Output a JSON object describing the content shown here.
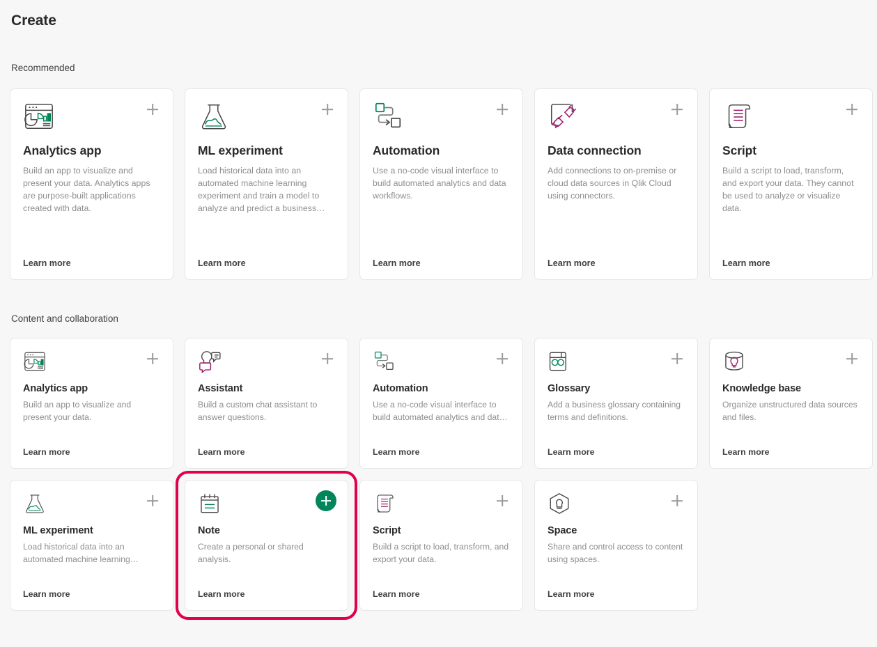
{
  "page": {
    "title": "Create"
  },
  "colors": {
    "background": "#f7f7f7",
    "card_background": "#ffffff",
    "card_border": "#e6e6e6",
    "accent_green": "#00865a",
    "focus_ring_pink": "#e0004d",
    "icon_green": "#00865a",
    "icon_magenta": "#9c1a6c",
    "icon_gray": "#4a4a4a",
    "title_text": "#2a2a2a",
    "body_text": "#8e8e8e"
  },
  "sections": [
    {
      "label": "Recommended",
      "card_size": "tall",
      "rows": [
        {
          "cards": [
            {
              "icon": "analytics-app-icon",
              "title": "Analytics app",
              "description": "Build an app to visualize and present your data. Analytics apps are purpose-built applications created with data.",
              "learn_more": "Learn more",
              "add_label": "+",
              "add_state": "default",
              "focused": false
            },
            {
              "icon": "ml-experiment-icon",
              "title": "ML experiment",
              "description": "Load historical data into an automated machine learning experiment and train a model to analyze and predict a business…",
              "learn_more": "Learn more",
              "add_label": "+",
              "add_state": "default",
              "focused": false
            },
            {
              "icon": "automation-icon",
              "title": "Automation",
              "description": "Use a no-code visual interface to build automated analytics and data workflows.",
              "learn_more": "Learn more",
              "add_label": "+",
              "add_state": "default",
              "focused": false
            },
            {
              "icon": "data-connection-icon",
              "title": "Data connection",
              "description": "Add connections to on-premise or cloud data sources in Qlik Cloud using connectors.",
              "learn_more": "Learn more",
              "add_label": "+",
              "add_state": "default",
              "focused": false
            },
            {
              "icon": "script-icon",
              "title": "Script",
              "description": "Build a script to load, transform, and export your data. They cannot be used to analyze or visualize data.",
              "learn_more": "Learn more",
              "add_label": "+",
              "add_state": "default",
              "focused": false
            }
          ]
        }
      ]
    },
    {
      "label": "Content and collaboration",
      "card_size": "short",
      "rows": [
        {
          "cards": [
            {
              "icon": "analytics-app-icon",
              "title": "Analytics app",
              "description": "Build an app to visualize and present your data.",
              "learn_more": "Learn more",
              "add_label": "+",
              "add_state": "default",
              "focused": false
            },
            {
              "icon": "assistant-icon",
              "title": "Assistant",
              "description": "Build a custom chat assistant to answer questions.",
              "learn_more": "Learn more",
              "add_label": "+",
              "add_state": "default",
              "focused": false
            },
            {
              "icon": "automation-icon",
              "title": "Automation",
              "description": "Use a no-code visual interface to build automated analytics and dat…",
              "learn_more": "Learn more",
              "add_label": "+",
              "add_state": "default",
              "focused": false
            },
            {
              "icon": "glossary-icon",
              "title": "Glossary",
              "description": "Add a business glossary containing terms and definitions.",
              "learn_more": "Learn more",
              "add_label": "+",
              "add_state": "default",
              "focused": false
            },
            {
              "icon": "knowledge-base-icon",
              "title": "Knowledge base",
              "description": "Organize unstructured data sources and files.",
              "learn_more": "Learn more",
              "add_label": "+",
              "add_state": "default",
              "focused": false
            }
          ]
        },
        {
          "cards": [
            {
              "icon": "ml-experiment-icon",
              "title": "ML experiment",
              "description": "Load historical data into an automated machine learning…",
              "learn_more": "Learn more",
              "add_label": "+",
              "add_state": "default",
              "focused": false
            },
            {
              "icon": "note-icon",
              "title": "Note",
              "description": "Create a personal or shared analysis.",
              "learn_more": "Learn more",
              "add_label": "+",
              "add_state": "active",
              "focused": true
            },
            {
              "icon": "script-icon",
              "title": "Script",
              "description": "Build a script to load, transform, and export your data.",
              "learn_more": "Learn more",
              "add_label": "+",
              "add_state": "default",
              "focused": false
            },
            {
              "icon": "space-icon",
              "title": "Space",
              "description": "Share and control access to content using spaces.",
              "learn_more": "Learn more",
              "add_label": "+",
              "add_state": "default",
              "focused": false
            }
          ]
        }
      ]
    }
  ]
}
